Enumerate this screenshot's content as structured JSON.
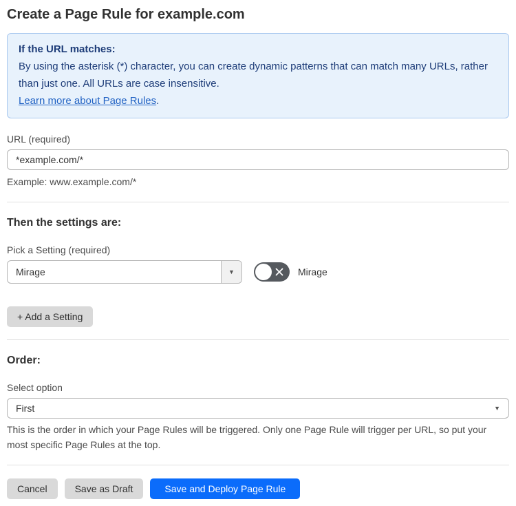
{
  "page": {
    "title": "Create a Page Rule for example.com"
  },
  "info_box": {
    "heading": "If the URL matches:",
    "body": "By using the asterisk (*) character, you can create dynamic patterns that can match many URLs, rather than just one. All URLs are case insensitive.",
    "link_label": "Learn more about Page Rules",
    "link_suffix": "."
  },
  "url_field": {
    "label": "URL (required)",
    "value": "*example.com/*",
    "helper": "Example: www.example.com/*"
  },
  "settings_section": {
    "heading": "Then the settings are:",
    "picker_label": "Pick a Setting (required)",
    "selected_setting": "Mirage",
    "dropdown_caret": "▼",
    "toggle": {
      "label": "Mirage",
      "state": "off"
    },
    "add_button_label": "+ Add a Setting"
  },
  "order_section": {
    "heading": "Order:",
    "select_label": "Select option",
    "selected_option": "First",
    "dropdown_caret": "▼",
    "helper": "This is the order in which your Page Rules will be triggered. Only one Page Rule will trigger per URL, so put your most specific Page Rules at the top."
  },
  "footer": {
    "cancel_label": "Cancel",
    "save_draft_label": "Save as Draft",
    "save_deploy_label": "Save and Deploy Page Rule"
  },
  "colors": {
    "accent_blue": "#0b6cfb",
    "info_background": "#e8f2fc",
    "info_border": "#a9c8ef",
    "info_text": "#1d3c78",
    "link_blue": "#2263c4",
    "toggle_off_gray": "#55595e",
    "button_gray": "#d9d9d9"
  }
}
